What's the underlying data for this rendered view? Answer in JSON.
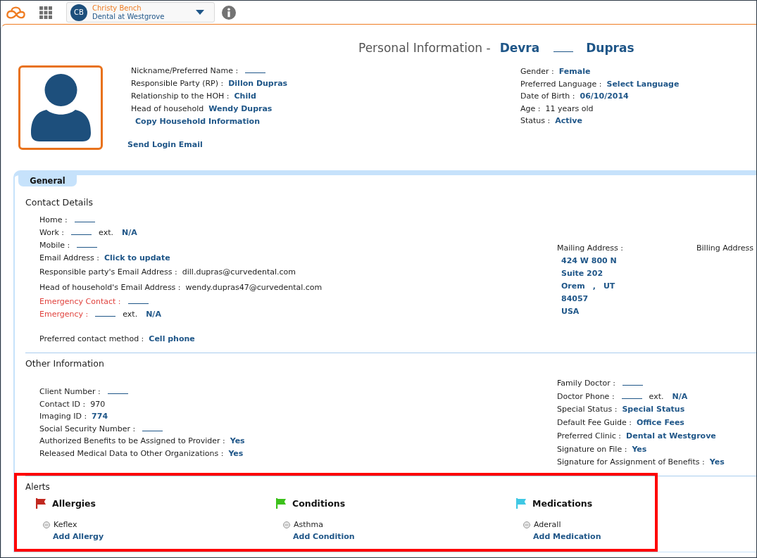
{
  "top_bar": {
    "user": {
      "initials": "CB",
      "name": "Christy Bench",
      "practice": "Dental at Westgrove"
    }
  },
  "header": {
    "title": "Personal Information -",
    "name_parts": [
      {
        "kind": "name",
        "value": "Devra"
      },
      {
        "kind": "blank"
      },
      {
        "kind": "name",
        "value": "Dupras"
      }
    ],
    "left_fields": [
      {
        "label": "Nickname/Preferred Name :",
        "kind": "blank"
      },
      {
        "label": "Responsible Party (RP) :",
        "kind": "link",
        "value": "Dillon Dupras"
      },
      {
        "label": "Relationship to the HOH :",
        "kind": "link",
        "value": "Child"
      },
      {
        "label": "Head of household",
        "kind": "link",
        "value": "Wendy Dupras"
      },
      {
        "label": "Copy Household Information",
        "kind": "action"
      }
    ],
    "send_login_email": "Send Login Email",
    "right_fields": [
      {
        "label": "Gender :",
        "kind": "link",
        "value": "Female"
      },
      {
        "label": "Preferred Language :",
        "kind": "link",
        "value": "Select Language"
      },
      {
        "label": "Date of Birth :",
        "kind": "link",
        "value": "06/10/2014"
      },
      {
        "label": "Age :",
        "kind": "text",
        "value": "11 years old"
      },
      {
        "label": "Status :",
        "kind": "link",
        "value": "Active"
      }
    ]
  },
  "tabs": [
    {
      "label": "General",
      "selected": true
    }
  ],
  "contact_details": {
    "title": "Contact Details",
    "rows": [
      {
        "label": "Home :",
        "kind": "blank",
        "warning": false
      },
      {
        "label": "Work :",
        "kind": "blank",
        "warning": false,
        "extension": {
          "label": "ext.",
          "value": "N/A"
        }
      },
      {
        "label": "Mobile :",
        "kind": "blank",
        "warning": false
      },
      {
        "label": "Email Address :",
        "kind": "link",
        "value": "Click to update",
        "warning": false
      },
      {
        "label": "Responsible party's Email Address :",
        "kind": "text",
        "value": "dill.dupras@curvedental.com",
        "warning": false
      },
      {
        "label": "Head of household's Email Address :",
        "kind": "text",
        "value": "wendy.dupras47@curvedental.com",
        "warning": false
      },
      {
        "label": "Emergency Contact :",
        "kind": "blank",
        "warning": true
      },
      {
        "label": "Emergency :",
        "kind": "blank",
        "warning": true,
        "extension": {
          "label": "ext.",
          "value": "N/A"
        }
      }
    ],
    "preferred_contact": {
      "label": "Preferred contact method :",
      "kind": "link",
      "value": "Cell phone",
      "warning": false
    },
    "mailing_address": {
      "label": "Mailing Address :",
      "lines": [
        [
          "424 W 800 N"
        ],
        [
          "Suite 202"
        ],
        [
          "Orem",
          ",",
          "UT"
        ],
        [
          "84057"
        ],
        [
          "USA"
        ]
      ]
    },
    "billing_address": {
      "label": "Billing Address"
    }
  },
  "other_information": {
    "title": "Other Information",
    "left_rows": [
      {
        "label": "Client Number :",
        "kind": "blank"
      },
      {
        "label": "Contact ID :",
        "kind": "text",
        "value": "970"
      },
      {
        "label": "Imaging ID :",
        "kind": "link",
        "value": "774"
      },
      {
        "label": "Social Security Number :",
        "kind": "blank"
      },
      {
        "label": "Authorized Benefits to be Assigned to Provider :",
        "kind": "link",
        "value": "Yes"
      },
      {
        "label": "Released Medical Data to Other Organizations :",
        "kind": "link",
        "value": "Yes"
      }
    ],
    "right_rows": [
      {
        "label": "Family Doctor :",
        "kind": "blank"
      },
      {
        "label": "Doctor Phone :",
        "kind": "blank",
        "extension": {
          "label": "ext.",
          "value": "N/A"
        }
      },
      {
        "label": "Special Status :",
        "kind": "link",
        "value": "Special Status"
      },
      {
        "label": "Default Fee Guide :",
        "kind": "link",
        "value": "Office Fees"
      },
      {
        "label": "Preferred Clinic :",
        "kind": "link",
        "value": "Dental at Westgrove"
      },
      {
        "label": "Signature on File :",
        "kind": "link",
        "value": "Yes"
      },
      {
        "label": "Signature for Assignment of Benefits :",
        "kind": "link",
        "value": "Yes"
      }
    ]
  },
  "alerts": {
    "title": "Alerts",
    "highlighted": true,
    "groups": [
      {
        "title": "Allergies",
        "color": "#c1281f",
        "items": [
          "Keflex"
        ],
        "add_link": "Add Allergy"
      },
      {
        "title": "Conditions",
        "color": "#3cc11b",
        "items": [
          "Asthma"
        ],
        "add_link": "Add Condition"
      },
      {
        "title": "Medications",
        "color": "#3fc8e4",
        "items": [
          "Aderall"
        ],
        "add_link": "Add Medication"
      }
    ]
  }
}
